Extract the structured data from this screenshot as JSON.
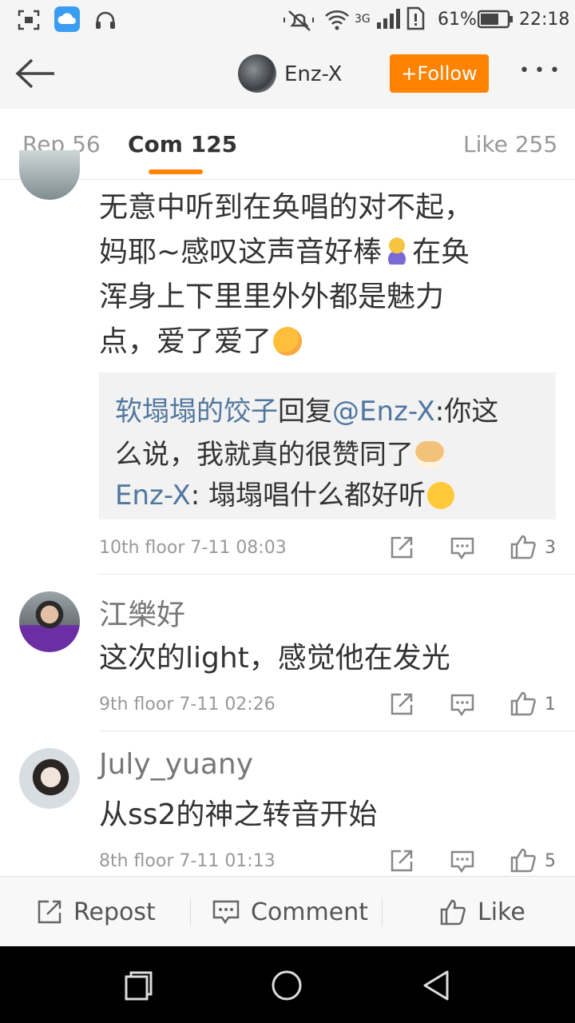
{
  "status_bar": {
    "battery": "61%",
    "time": "22:18",
    "network": "3G"
  },
  "header": {
    "username": "Enz-X",
    "follow_label": "+Follow",
    "more_label": "•••"
  },
  "tabs": [
    {
      "label": "Rep 56"
    },
    {
      "label": "Com 125"
    },
    {
      "label": "Like 255"
    }
  ],
  "comments": [
    {
      "lines": [
        "无意中听到在奂唱的对不起，",
        "妈耶~感叹这声音好棒",
        "在奂",
        "浑身上下里里外外都是魅力",
        "点，爱了爱了"
      ],
      "replies": [
        {
          "user": "软塌塌的饺子",
          "reply_word": "回复",
          "mention": "@Enz-X",
          "text_1": ":你这",
          "text_2": "么说，我就真的很赞同了"
        },
        {
          "user": "Enz-X",
          "text": ": 塌塌唱什么都好听"
        }
      ],
      "floor": "10th floor",
      "time": "7-11 08:03",
      "likes": "3"
    },
    {
      "user": "江樂好",
      "text": "这次的light，感觉他在发光",
      "floor": "9th floor",
      "time": "7-11 02:26",
      "likes": "1"
    },
    {
      "user": "July_yuany",
      "text": "从ss2的神之转音开始",
      "floor": "8th floor",
      "time": "7-11 01:13",
      "likes": "5"
    }
  ],
  "bottom_bar": {
    "repost": "Repost",
    "comment": "Comment",
    "like": "Like"
  },
  "colors": {
    "accent": "#ff8200",
    "link": "#50779f",
    "meta": "#999999"
  }
}
